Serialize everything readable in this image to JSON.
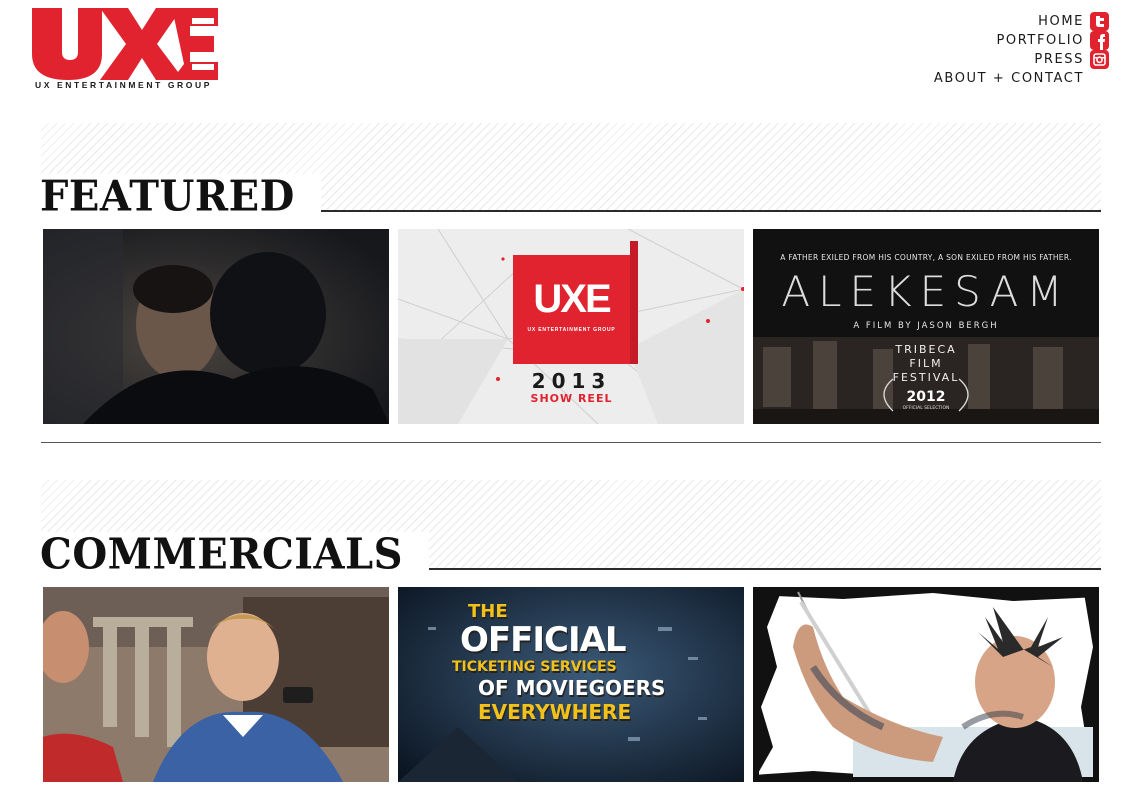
{
  "brand": {
    "logo_text": "UXE",
    "tagline": "UX ENTERTAINMENT GROUP",
    "accent": "#e0232f"
  },
  "nav": {
    "items": [
      {
        "label": "HOME"
      },
      {
        "label": "PORTFOLIO"
      },
      {
        "label": "PRESS"
      },
      {
        "label": "ABOUT + CONTACT"
      }
    ],
    "social": [
      "twitter-icon",
      "facebook-icon",
      "instagram-icon"
    ]
  },
  "sections": {
    "featured": {
      "title": "FEATURED",
      "thumbs": [
        {
          "kind": "film-still-dark"
        },
        {
          "kind": "show-reel",
          "logo": "UXE",
          "logo_sub": "UX ENTERTAINMENT GROUP",
          "year": "2013",
          "label": "SHOW REEL"
        },
        {
          "kind": "film-poster",
          "tagline": "A FATHER EXILED FROM HIS COUNTRY, A SON EXILED FROM HIS FATHER.",
          "title": "ALEKESAM",
          "credit": "A FILM BY JASON BERGH",
          "festival_lines": [
            "TRIBECA",
            "FILM",
            "FESTIVAL"
          ],
          "festival_year": "2012",
          "selection": "OFFICIAL SELECTION"
        }
      ]
    },
    "commercials": {
      "title": "COMMERCIALS",
      "thumbs": [
        {
          "kind": "commercial-still"
        },
        {
          "kind": "ticketing-promo",
          "lines": [
            "THE",
            "OFFICIAL",
            "TICKETING SERVICES",
            "OF MOVIEGOERS",
            "EVERYWHERE"
          ]
        },
        {
          "kind": "drummer-still"
        }
      ]
    }
  }
}
